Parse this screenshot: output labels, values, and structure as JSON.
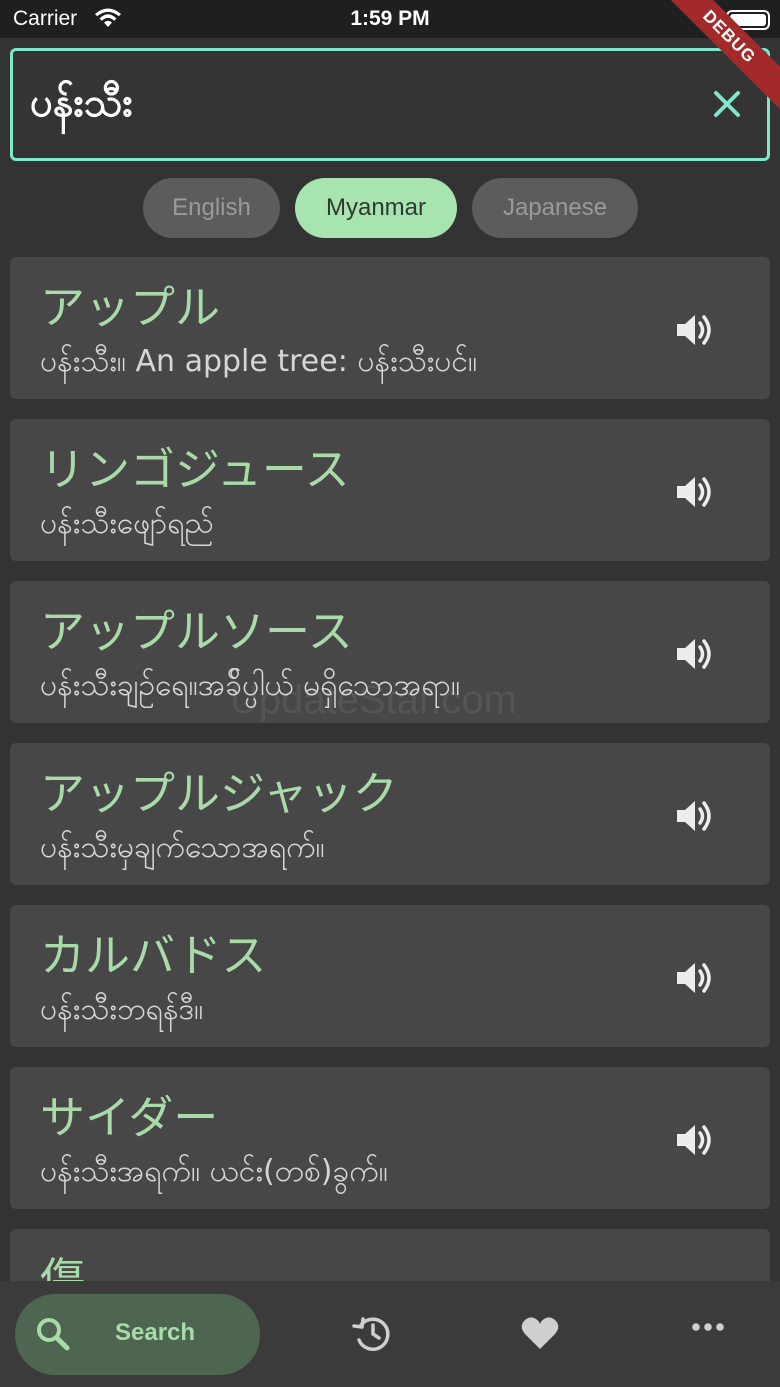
{
  "status_bar": {
    "carrier": "Carrier",
    "time": "1:59 PM"
  },
  "debug_banner": "DEBUG",
  "search": {
    "value": "ပန်းသီး"
  },
  "languages": [
    {
      "label": "English",
      "selected": false
    },
    {
      "label": "Myanmar",
      "selected": true
    },
    {
      "label": "Japanese",
      "selected": false
    }
  ],
  "results": [
    {
      "title": "アップル",
      "description": "ပန်းသီး။ An apple tree: ပန်းသီးပင်။"
    },
    {
      "title": "リンゴジュース",
      "description": "ပန်းသီးဖျော်ရည်"
    },
    {
      "title": "アップルソース",
      "description": "ပန်းသီးချဉ်ရေ။အခ်ိပ္ပါယ် မရှိသောအရာ။"
    },
    {
      "title": "アップルジャック",
      "description": "ပန်းသီးမှချက်သောအရက်။"
    },
    {
      "title": "カルバドス",
      "description": "ပန်းသီးဘရန်ဒီ။"
    },
    {
      "title": "サイダー",
      "description": "ပန်းသီးအရက်။ ယင်း(တစ်)ခွက်။"
    },
    {
      "title": "傷",
      "description": ""
    }
  ],
  "watermark": "UpdateStar.com",
  "bottom_nav": {
    "search_label": "Search"
  },
  "colors": {
    "accent": "#7ee7cc",
    "title_green": "#a8dba8",
    "chip_selected": "#a8e4b0"
  },
  "icons": [
    "wifi-icon",
    "battery-icon",
    "close-icon",
    "speaker-icon",
    "search-icon",
    "history-icon",
    "heart-icon",
    "more-icon"
  ]
}
